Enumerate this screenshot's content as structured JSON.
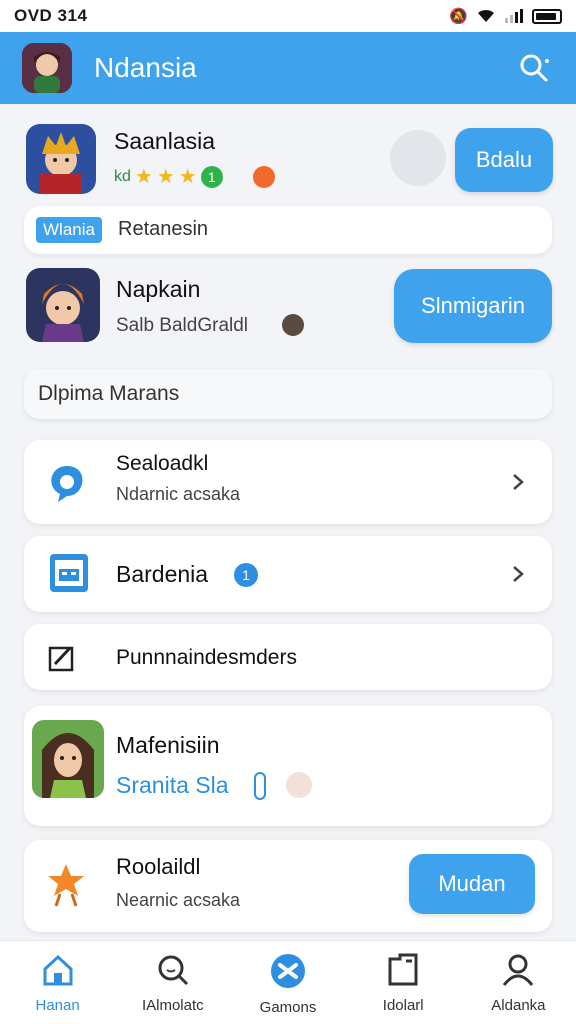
{
  "status": {
    "time": "OVD 314"
  },
  "app_bar": {
    "title": "Ndansia"
  },
  "featured": {
    "name": "Saanlasia",
    "rating_text": "kd",
    "badge_count": "1",
    "action_label": "Bdalu"
  },
  "tag_row": {
    "tag": "Wlania",
    "text": "Retanesin"
  },
  "game2": {
    "name": "Napkain",
    "subtitle": "Salb BaldGraldl",
    "action_label": "Slnmigarin"
  },
  "section": {
    "title": "Dlpima Marans"
  },
  "list": [
    {
      "title": "Sealoadkl",
      "subtitle": "Ndarnic acsaka"
    },
    {
      "title": "Bardenia",
      "badge": "1"
    },
    {
      "title": "Punnnaindesmders"
    }
  ],
  "game3": {
    "name": "Mafenisiin",
    "subtitle": "Sranita Sla"
  },
  "game4": {
    "name": "Roolaildl",
    "subtitle": "Nearnic acsaka",
    "action_label": "Mudan"
  },
  "tabs": [
    {
      "label": "Hanan",
      "icon": "home-icon"
    },
    {
      "label": "IAlmolatc",
      "icon": "search-icon"
    },
    {
      "label": "Gamons",
      "icon": "games-icon"
    },
    {
      "label": "Idolarl",
      "icon": "library-icon"
    },
    {
      "label": "Aldanka",
      "icon": "profile-icon"
    }
  ],
  "colors": {
    "accent": "#3ea3ec",
    "background": "#f2f4f7"
  }
}
